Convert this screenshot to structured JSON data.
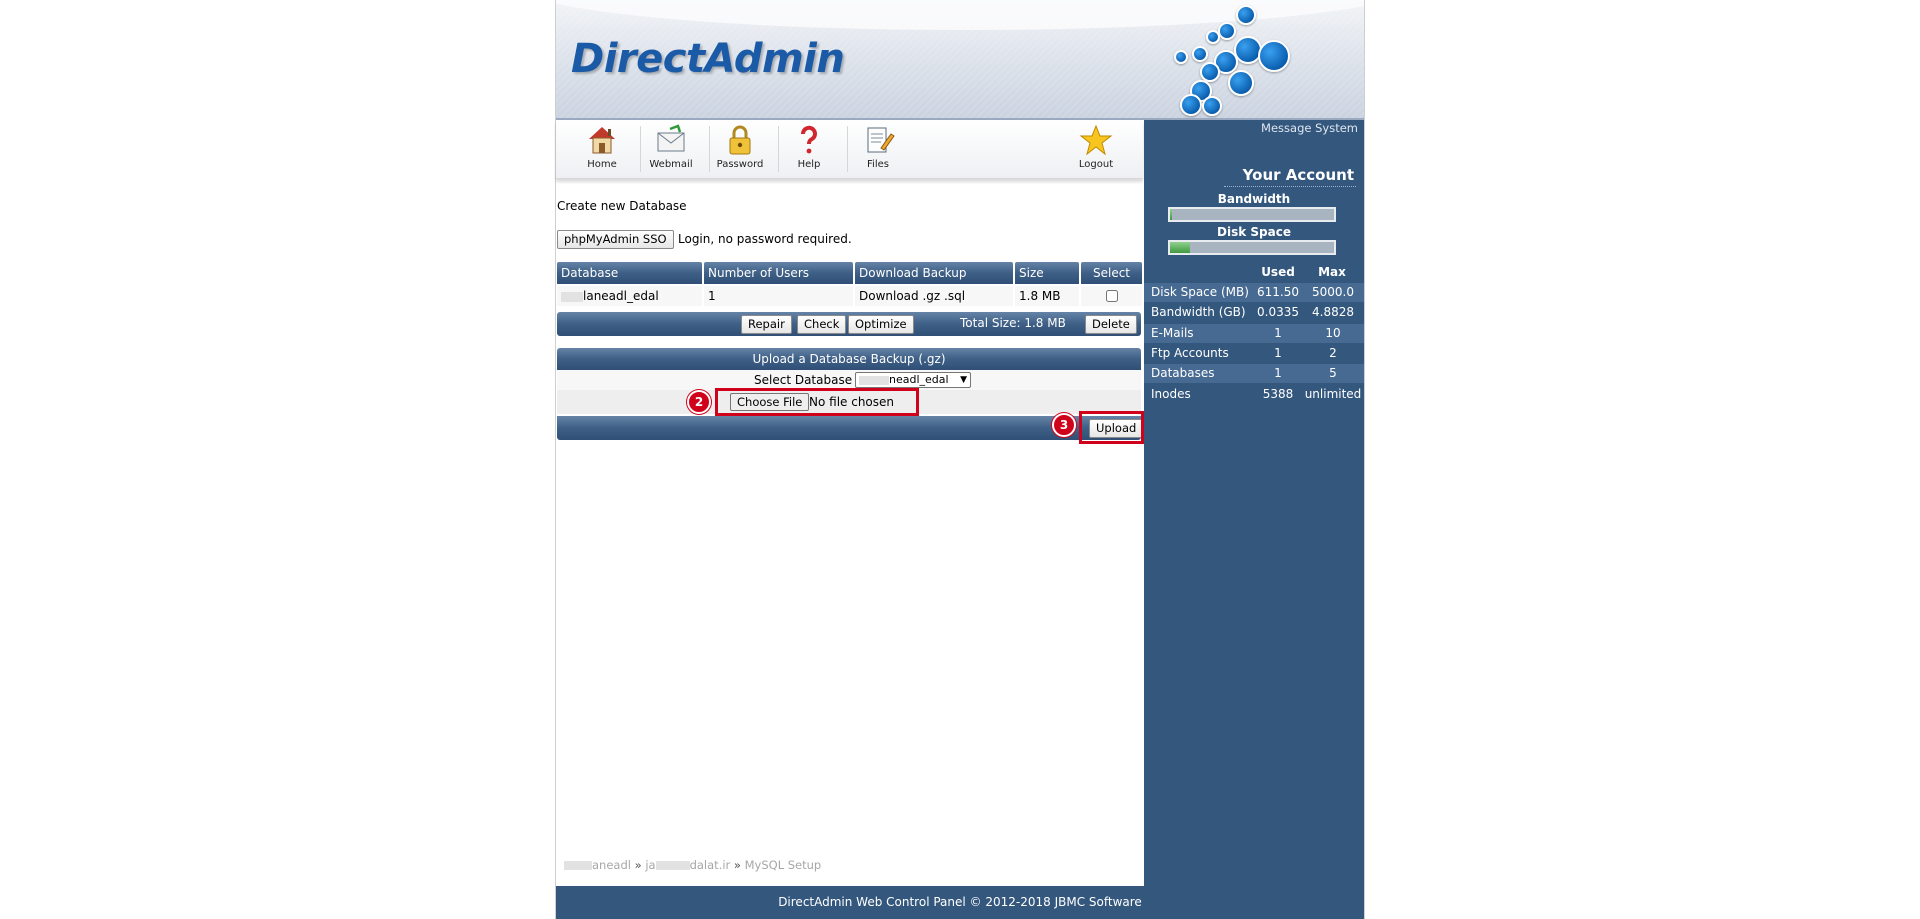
{
  "brand": {
    "logo_text": "DirectAdmin"
  },
  "toolbar": {
    "items": [
      {
        "label": "Home",
        "icon": "home-icon"
      },
      {
        "label": "Webmail",
        "icon": "webmail-icon"
      },
      {
        "label": "Password",
        "icon": "lock-icon"
      },
      {
        "label": "Help",
        "icon": "help-icon"
      },
      {
        "label": "Files",
        "icon": "files-icon"
      },
      {
        "label": "Logout",
        "icon": "logout-star-icon"
      }
    ]
  },
  "main": {
    "create_link": "Create new Database",
    "sso_button": "phpMyAdmin SSO",
    "sso_note": "Login, no password required.",
    "table": {
      "headers": [
        "Database",
        "Number of Users",
        "Download Backup",
        "Size",
        "Select"
      ],
      "rows": [
        {
          "database": "laneadl_edal",
          "users": "1",
          "download_gz": "Download .gz",
          "download_sql": ".sql",
          "size": "1.8 MB",
          "selected": false
        }
      ]
    },
    "actions": {
      "repair": "Repair",
      "check": "Check",
      "optimize": "Optimize",
      "total_size": "Total Size: 1.8 MB",
      "delete": "Delete"
    },
    "upload": {
      "title": "Upload a Database Backup (.gz)",
      "select_label": "Select Database",
      "selected_db": "neadl_edal",
      "choose_file": "Choose File",
      "file_status": "No file chosen",
      "upload_button": "Upload",
      "step_choose": "2",
      "step_upload": "3",
      "annotation_color": "#d0021b"
    },
    "breadcrumb": {
      "user": "aneadl",
      "domain_start": "ja",
      "domain_end": "dalat.ir",
      "page": "MySQL Setup",
      "separator": "»"
    }
  },
  "sidebar": {
    "message_system": "Message System",
    "title": "Your Account",
    "bandwidth_label": "Bandwidth",
    "bandwidth_fraction": 0.01,
    "disk_label": "Disk Space",
    "disk_fraction": 0.12,
    "col_used": "Used",
    "col_max": "Max",
    "stats": [
      {
        "name": "Disk Space (MB)",
        "used": "611.50",
        "max": "5000.0"
      },
      {
        "name": "Bandwidth (GB)",
        "used": "0.0335",
        "max": "4.8828"
      },
      {
        "name": "E-Mails",
        "used": "1",
        "max": "10"
      },
      {
        "name": "Ftp Accounts",
        "used": "1",
        "max": "2"
      },
      {
        "name": "Databases",
        "used": "1",
        "max": "5"
      },
      {
        "name": "Inodes",
        "used": "5388",
        "max": "unlimited"
      }
    ]
  },
  "footer": {
    "text": "DirectAdmin Web Control Panel © 2012-2018 JBMC Software"
  }
}
